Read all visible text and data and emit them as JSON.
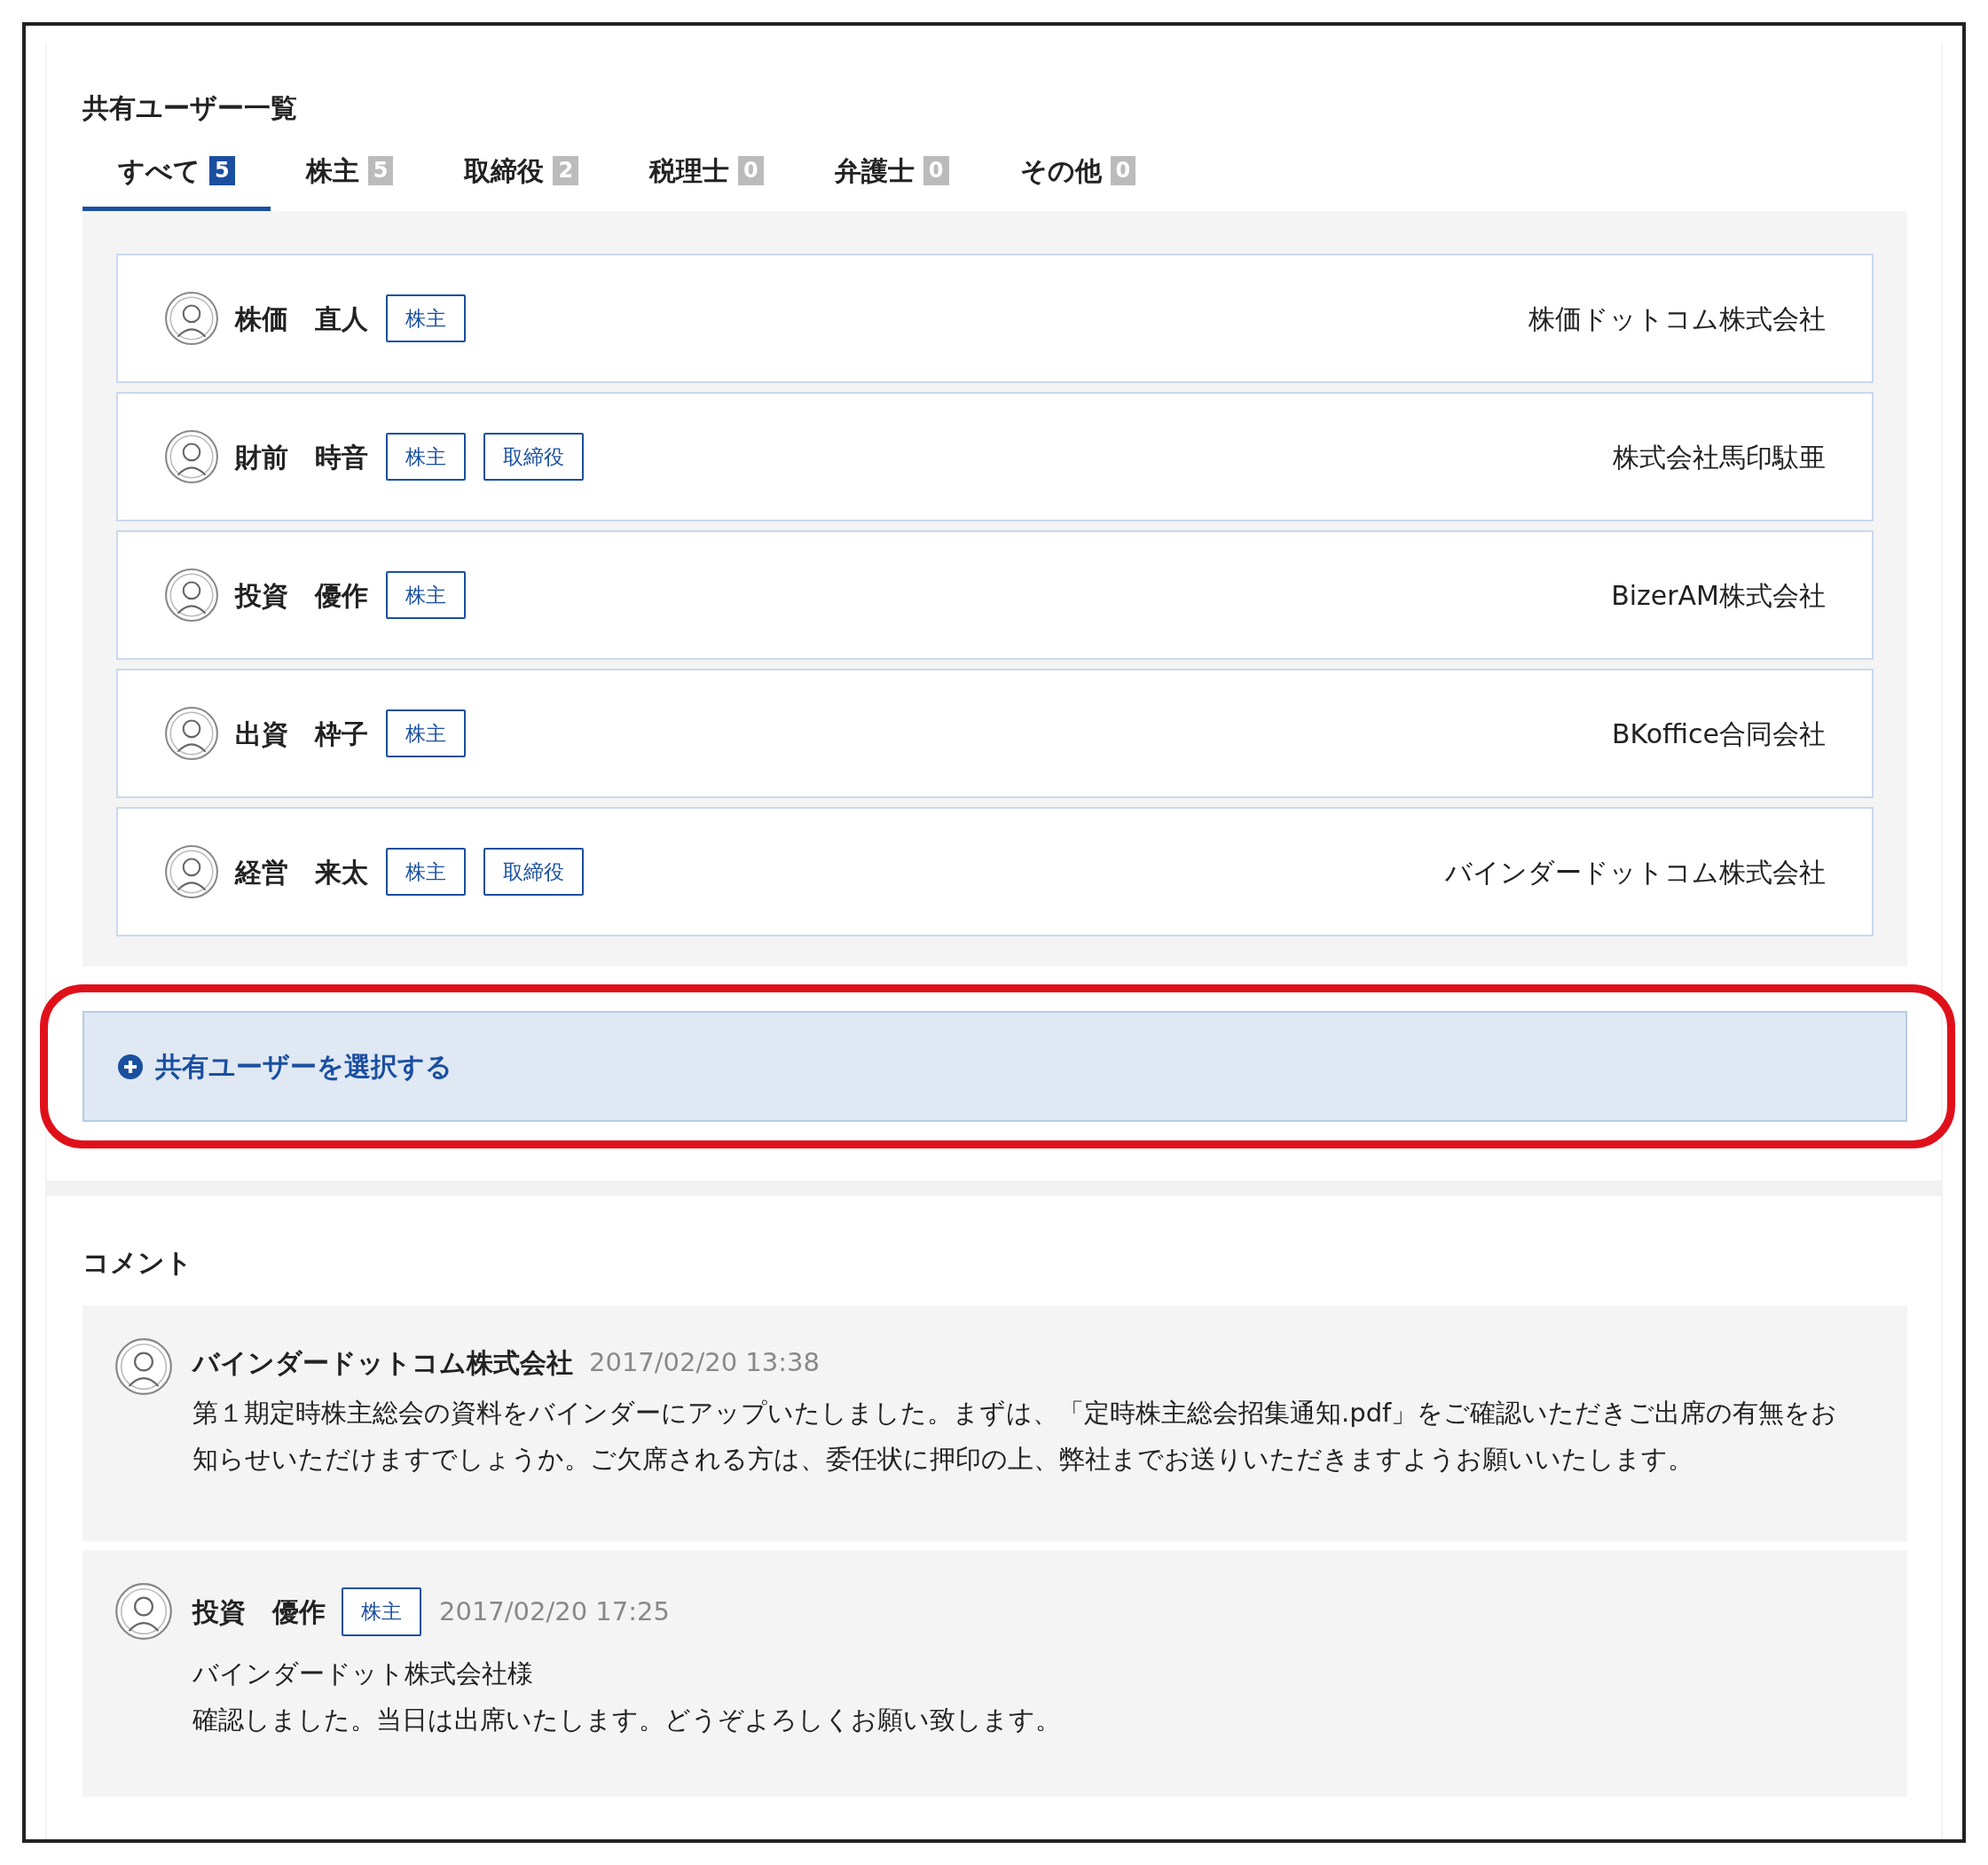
{
  "title": "共有ユーザー一覧",
  "tabs": [
    {
      "label": "すべて",
      "count": "5",
      "selected": true
    },
    {
      "label": "株主",
      "count": "5",
      "selected": false
    },
    {
      "label": "取締役",
      "count": "2",
      "selected": false
    },
    {
      "label": "税理士",
      "count": "0",
      "selected": false
    },
    {
      "label": "弁護士",
      "count": "0",
      "selected": false
    },
    {
      "label": "その他",
      "count": "0",
      "selected": false
    }
  ],
  "users": [
    {
      "name": "株価　直人",
      "tags": [
        "株主"
      ],
      "company": "株価ドットコム株式会社"
    },
    {
      "name": "財前　時音",
      "tags": [
        "株主",
        "取締役"
      ],
      "company": "株式会社馬印駄亜"
    },
    {
      "name": "投資　優作",
      "tags": [
        "株主"
      ],
      "company": "BizerAM株式会社"
    },
    {
      "name": "出資　枠子",
      "tags": [
        "株主"
      ],
      "company": "BKoffice合同会社"
    },
    {
      "name": "経営　来太",
      "tags": [
        "株主",
        "取締役"
      ],
      "company": "バインダードットコム株式会社"
    }
  ],
  "add_button": {
    "label": "共有ユーザーを選択する",
    "highlighted": true
  },
  "comments_title": "コメント",
  "comments": [
    {
      "author": "バインダードットコム株式会社",
      "time": "2017/02/20 13:38",
      "lines": [
        "第１期定時株主総会の資料をバインダーにアップいたしました。まずは、「定時株主総会招集通知.pdf」をご確認いただきご出席の有無をお知らせいただけますでしょうか。ご欠席される方は、委任状に押印の上、弊社までお送りいただきますようお願いいたします。"
      ]
    },
    {
      "author": "投資　優作",
      "tags": [
        "株主"
      ],
      "time": "2017/02/20 17:25",
      "lines": [
        "バインダードット株式会社様",
        "確認しました。当日は出席いたします。どうぞよろしくお願い致します。"
      ]
    }
  ]
}
